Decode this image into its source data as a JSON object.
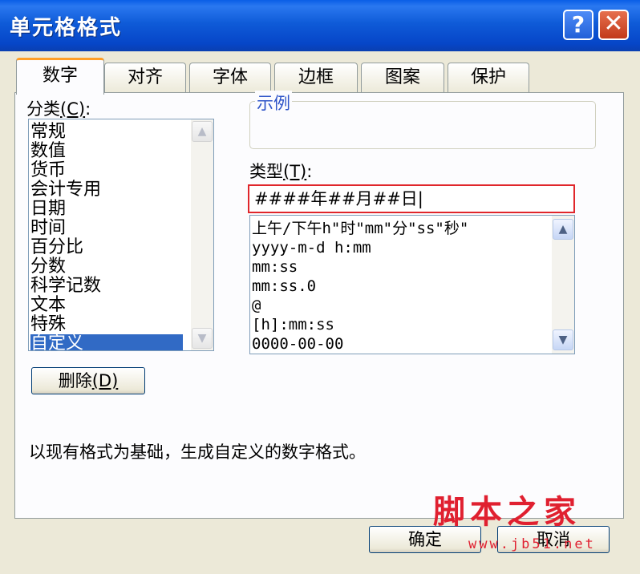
{
  "window": {
    "title": "单元格格式",
    "help_glyph": "?",
    "close_glyph": "✕"
  },
  "tabs": [
    "数字",
    "对齐",
    "字体",
    "边框",
    "图案",
    "保护"
  ],
  "category": {
    "label": "分类",
    "mnemonic": "(C)",
    "colon": ":",
    "items": [
      "常规",
      "数值",
      "货币",
      "会计专用",
      "日期",
      "时间",
      "百分比",
      "分数",
      "科学记数",
      "文本",
      "特殊",
      "自定义"
    ],
    "selected_index": 11
  },
  "sample": {
    "label": "示例",
    "value": ""
  },
  "type": {
    "label": "类型",
    "mnemonic": "(T)",
    "colon": ":",
    "input_value": "####年##月##日|",
    "items": [
      "上午/下午h\"时\"mm\"分\"ss\"秒\"",
      "yyyy-m-d h:mm",
      "mm:ss",
      "mm:ss.0",
      "@",
      "[h]:mm:ss",
      "0000-00-00"
    ]
  },
  "buttons": {
    "delete": "删除",
    "delete_mnemonic": "(D)",
    "ok": "确定",
    "cancel": "取消"
  },
  "description": "以现有格式为基础，生成自定义的数字格式。",
  "watermark": {
    "text": "脚本之家",
    "url": "www.jb51.net"
  },
  "icons": {
    "scroll_up": "▲",
    "scroll_down": "▼"
  },
  "colors": {
    "title_bar": "#0a5ee6",
    "selection": "#316ac5",
    "highlight_border": "#e0262b",
    "active_tab": "#ff9e26"
  }
}
